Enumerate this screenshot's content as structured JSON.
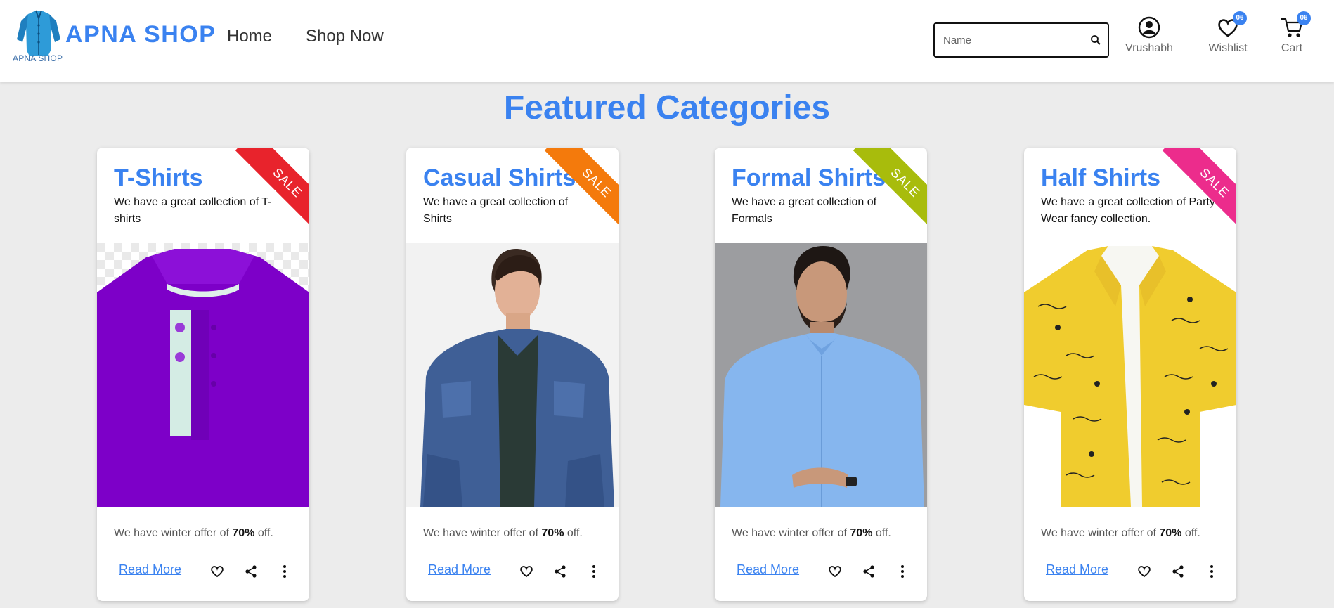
{
  "header": {
    "logo_text": "APNA SHOP",
    "brand": "APNA SHOP",
    "nav": [
      {
        "label": "Home"
      },
      {
        "label": "Shop Now"
      }
    ],
    "search": {
      "placeholder": "Name",
      "value": ""
    },
    "user": {
      "label": "Vrushabh",
      "icon": "user-circle-icon"
    },
    "wishlist": {
      "label": "Wishlist",
      "count": "06",
      "icon": "heart-icon"
    },
    "cart": {
      "label": "Cart",
      "count": "06",
      "icon": "cart-icon"
    }
  },
  "main": {
    "title": "Featured Categories",
    "cards": [
      {
        "title": "T-Shirts",
        "desc": "We have a great collection of T-shirts",
        "ribbon": "SALE",
        "ribbon_color": "#e8232c",
        "offer_prefix": "We have winter offer of ",
        "offer_value": "70%",
        "offer_suffix": " off.",
        "read_more": "Read More"
      },
      {
        "title": "Casual Shirts",
        "desc": "We have a great collection of Shirts",
        "ribbon": "SALE",
        "ribbon_color": "#f47a0c",
        "offer_prefix": "We have winter offer of ",
        "offer_value": "70%",
        "offer_suffix": " off.",
        "read_more": "Read More"
      },
      {
        "title": "Formal Shirts",
        "desc": "We have a great collection of Formals",
        "ribbon": "SALE",
        "ribbon_color": "#a8bc0c",
        "offer_prefix": "We have winter offer of ",
        "offer_value": "70%",
        "offer_suffix": " off.",
        "read_more": "Read More"
      },
      {
        "title": "Half Shirts",
        "desc": "We have a great collection of Party Wear fancy collection.",
        "ribbon": "SALE",
        "ribbon_color": "#ec2c8c",
        "offer_prefix": "We have winter offer of ",
        "offer_value": "70%",
        "offer_suffix": " off.",
        "read_more": "Read More"
      }
    ]
  },
  "colors": {
    "accent": "#3a82f0",
    "page_bg": "#ececec"
  }
}
